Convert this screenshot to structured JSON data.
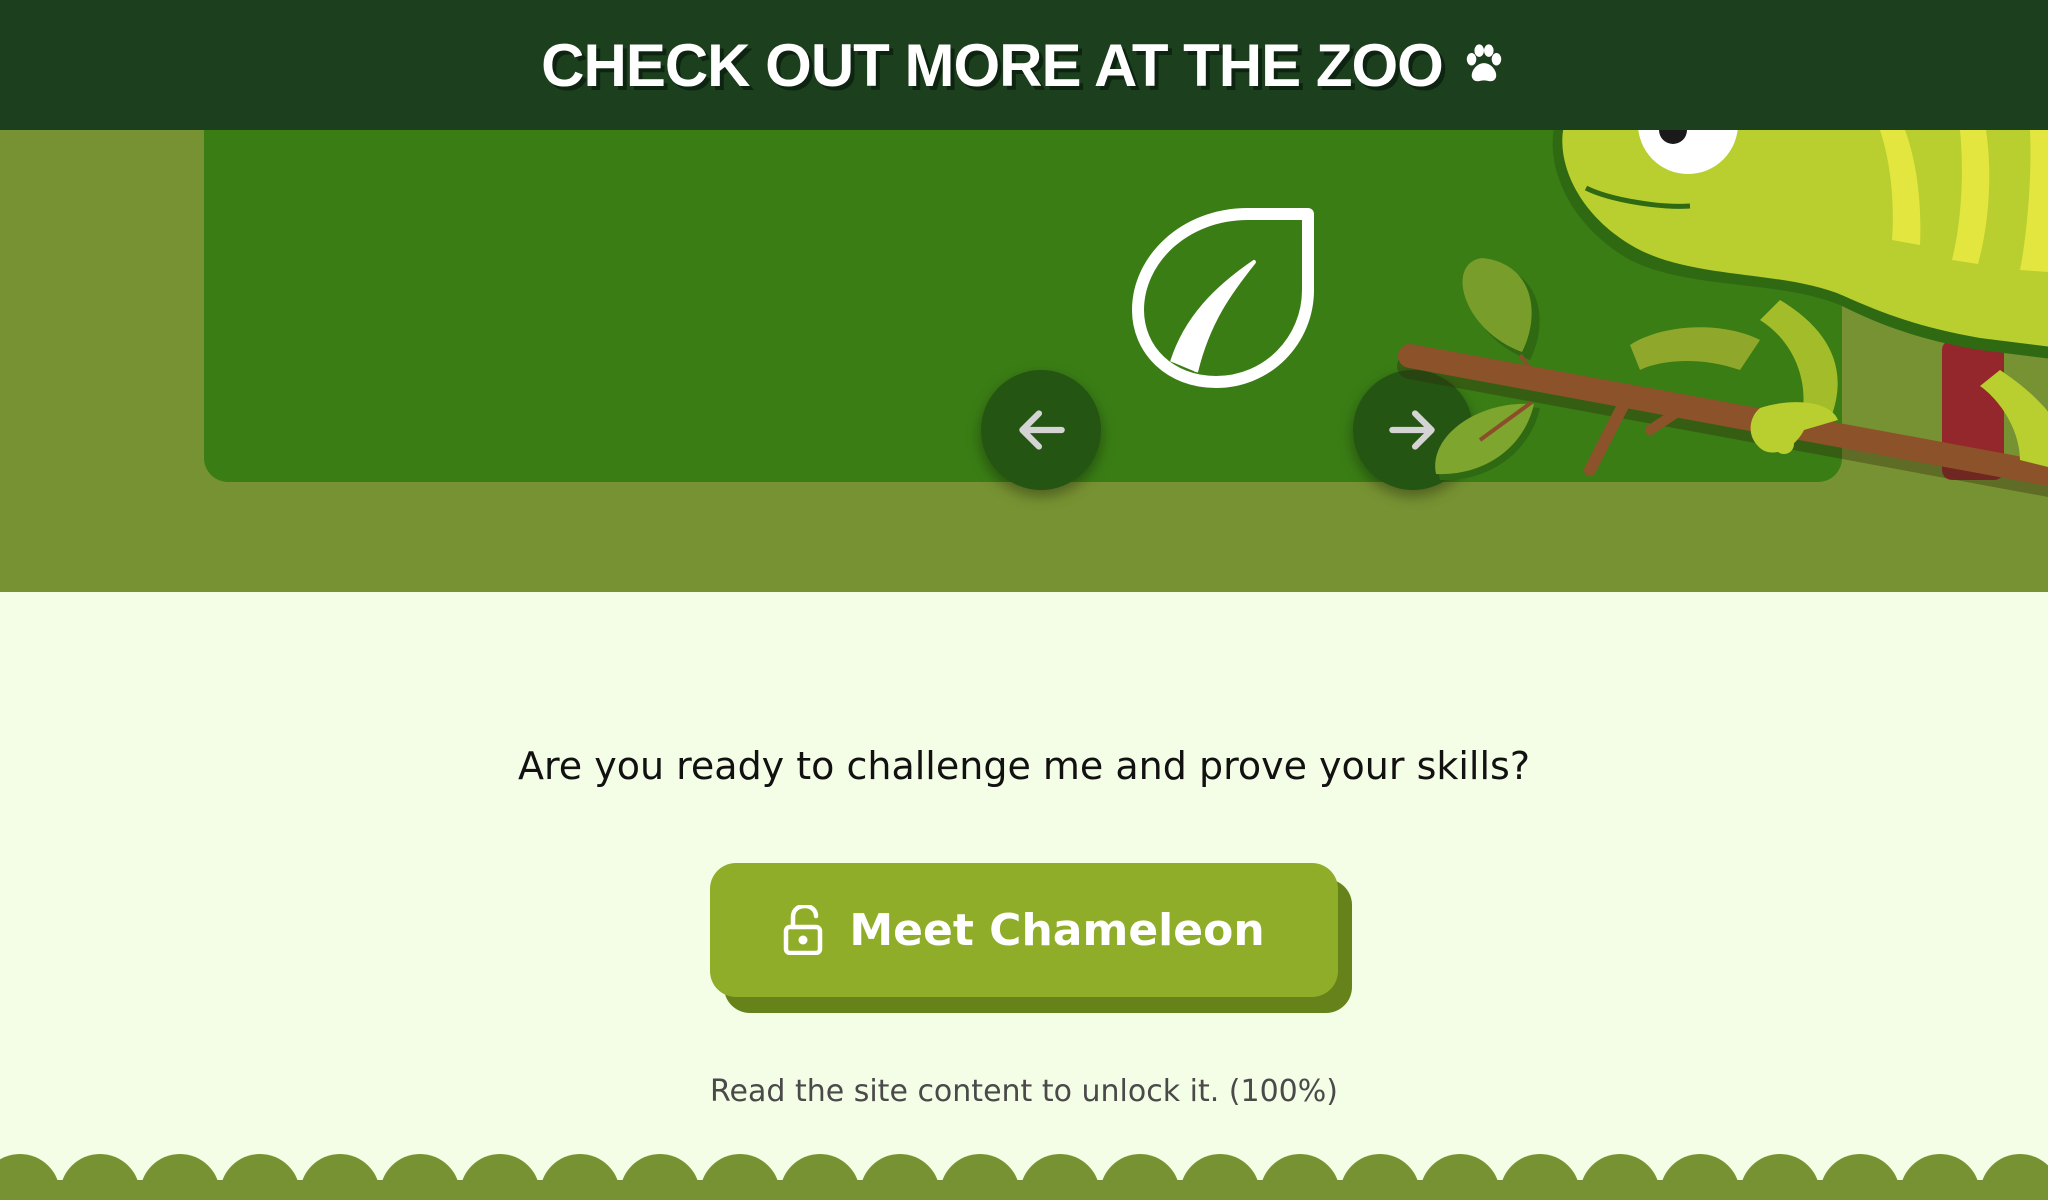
{
  "header": {
    "title": "CHECK OUT MORE AT THE ZOO",
    "icon": "paw-icon"
  },
  "hero": {
    "center_icon": "leaf-icon",
    "prev_button": {
      "icon": "arrow-left-icon"
    },
    "next_button": {
      "icon": "arrow-right-icon"
    },
    "illustration": "chameleon-on-branch"
  },
  "main": {
    "prompt": "Are you ready to challenge me and prove your skills?",
    "cta": {
      "label": "Meet Chameleon",
      "icon": "unlock-icon"
    },
    "hint": "Read the site content to unlock it. (100%)",
    "progress_percent": 100
  },
  "colors": {
    "header_bg": "#1c3f1e",
    "hero_bg": "#779232",
    "panel_bg": "#3a7d15",
    "page_bg": "#f4fde6",
    "button": "#8fad29",
    "button_shadow": "#66821b"
  }
}
